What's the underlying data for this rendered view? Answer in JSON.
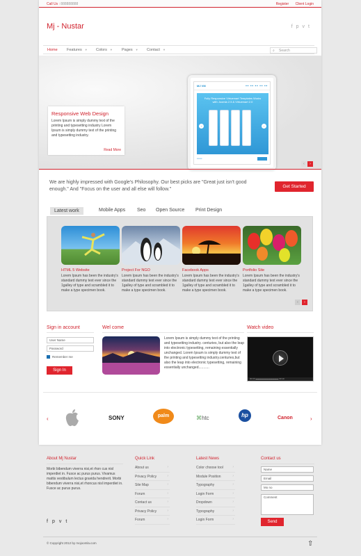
{
  "topbar": {
    "call_label": "Call Us :",
    "phone": "888888888",
    "links": [
      "Register",
      "Client Login"
    ]
  },
  "brand": {
    "logo": "Mj - Nustar"
  },
  "social_icons": [
    "facebook-icon",
    "pinterest-icon",
    "vimeo-icon",
    "twitter-icon"
  ],
  "nav": {
    "items": [
      "Home",
      "Features",
      "Colors",
      "Pages",
      "Contact"
    ],
    "active": "Home",
    "search_placeholder": "Search"
  },
  "hero": {
    "caption_title": "Responsive Web Design",
    "caption_text": "Lorem Ipsum is simply dummy text of the printing and typesetting industry Lorem Ipsum is simply dummy text of the printing and typesetting industry.",
    "read_more": "Read More",
    "tablet": {
      "logo": "MJ VM",
      "headline": "Fully Responsive Virtuemart Templates Works with Joomla 2.5 & Virtuemart 2.0"
    }
  },
  "quote": {
    "text": "We are highly impressed with Google's Philosophy. Our best picks are \"Great just isn't good enough.\" And \"Focus on the user and all else will follow.\"",
    "button": "Get Started"
  },
  "works": {
    "tabs": [
      "Latest work",
      "Mobile Apps",
      "Seo",
      "Open Source",
      "Print Design"
    ],
    "active": "Latest work",
    "items": [
      {
        "title": "HTML 5 Website",
        "desc": "Lorem Ipsum has been the industry's standard dummy text ever since the 1galley of type and scrambled it to make a type specimen book."
      },
      {
        "title": "Project For NGO",
        "desc": "Lorem Ipsum has been the industry's standard dummy text ever since the 1galley of type and scrambled it to make a type specimen book."
      },
      {
        "title": "Facebook Apps",
        "desc": "Lorem Ipsum has been the industry's standard dummy text ever since the 1galley of type and scrambled it to make a type specimen book."
      },
      {
        "title": "Portfolio Site",
        "desc": "Lorem Ipsum has been the industry's standard dummy text ever since the 1galley of type and scrambled it to make a type specimen book."
      }
    ]
  },
  "signin": {
    "title": "Sign in account",
    "username_placeholder": "User Name",
    "password_placeholder": "Password",
    "remember": "Remember me",
    "button": "Sign In"
  },
  "welcome": {
    "title": "Wel come",
    "text": "Lorem Ipsum is simply dummy text of the printing and typesetting industry. centuries, but also the leap into electronic typesetting, remaining essentially unchanged. Lorem Ipsum is simply dummy text of the printing and typesetting industry.centuries,but also the leap into electronic typesetting, remaining essentially unchanged..........."
  },
  "video": {
    "title": "Watch video",
    "time_current": "00:00",
    "time_total": "00:10"
  },
  "brands": [
    "SONY",
    "palm",
    "htc",
    "hp",
    "Canon"
  ],
  "footer": {
    "about": {
      "title": "About Mj Nustar",
      "text": "Morbi bibendum viverra nisi,et rhon cus nisl imperdiet in. Fusce ac purus purus. Vivamus mattis vestibulum lectus gravida hendrerit. Morbi bibendum viverra nisi,et rhoncus nisl imperdiet in. Fusce ac purus purus."
    },
    "quick": {
      "title": "Quick Link",
      "items": [
        "About us",
        "Privacy Policy",
        "Site Map",
        "Forum",
        "Contact us",
        "Privacy Policy",
        "Forum"
      ]
    },
    "news": {
      "title": "Latest News",
      "items": [
        "Color choose tool",
        "Module Position",
        "Typography",
        "Login Form",
        "Dropdown",
        "Typography",
        "Login Form"
      ]
    },
    "contact": {
      "title": "Contact us",
      "name": "Name",
      "email": "Email",
      "mobile": "Mo no",
      "comment": "Comment",
      "button": "Send"
    },
    "copyright": "© Copyright 2012 by mojoomla.com"
  }
}
